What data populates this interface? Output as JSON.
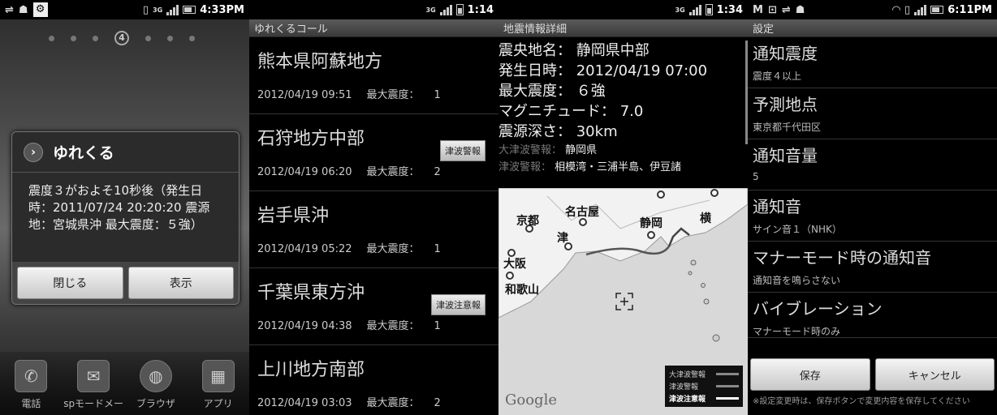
{
  "screen1": {
    "status_time": "4:33PM",
    "page_indicator": "4",
    "dialog": {
      "title": "ゆれくる",
      "body": "震度３がおよそ10秒後（発生日時：2011/07/24 20:20:20 震源地：宮城県沖 最大震度：５強）",
      "close_label": "閉じる",
      "show_label": "表示"
    },
    "dock": [
      {
        "label": "電話",
        "icon": "phone-icon"
      },
      {
        "label": "spモードメー",
        "icon": "mail-icon"
      },
      {
        "label": "ブラウザ",
        "icon": "globe-icon"
      },
      {
        "label": "アプリ",
        "icon": "grid-icon"
      }
    ]
  },
  "screen2": {
    "status_time": "1:14",
    "network": "3G",
    "title": "ゆれくるコール",
    "max_label": "最大震度：",
    "items": [
      {
        "place": "熊本県阿蘇地方",
        "datetime": "2012/04/19 09:51",
        "max": "1",
        "tag": ""
      },
      {
        "place": "石狩地方中部",
        "datetime": "2012/04/19 06:20",
        "max": "2",
        "tag": "津波警報"
      },
      {
        "place": "岩手県沖",
        "datetime": "2012/04/19 05:22",
        "max": "1",
        "tag": ""
      },
      {
        "place": "千葉県東方沖",
        "datetime": "2012/04/19 04:38",
        "max": "1",
        "tag": "津波注意報"
      },
      {
        "place": "上川地方南部",
        "datetime": "2012/04/19 03:03",
        "max": "2",
        "tag": ""
      }
    ]
  },
  "screen3": {
    "status_time": "1:34",
    "network": "3G",
    "title": "地震情報詳細",
    "rows": [
      {
        "label": "震央地名：",
        "value": "静岡県中部"
      },
      {
        "label": "発生日時：",
        "value": "2012/04/19 07:00"
      },
      {
        "label": "最大震度：",
        "value": "６強"
      },
      {
        "label": "マグニチュード：",
        "value": "7.0"
      },
      {
        "label": "震源深さ：",
        "value": "30km"
      }
    ],
    "small_rows": [
      {
        "label": "大津波警報：",
        "value": "静岡県"
      },
      {
        "label": "津波警報：",
        "value": "相模湾・三浦半島、伊豆諸"
      }
    ],
    "map": {
      "cities": [
        "京都",
        "名古屋",
        "静岡",
        "津",
        "大阪",
        "和歌山",
        "横"
      ],
      "legend": [
        "大津波警報",
        "津波警報",
        "津波注意報"
      ],
      "attribution": "Google"
    }
  },
  "screen4": {
    "status_time": "6:11PM",
    "title": "設定",
    "items": [
      {
        "title": "通知震度",
        "value": "震度４以上"
      },
      {
        "title": "予測地点",
        "value": "東京都千代田区"
      },
      {
        "title": "通知音量",
        "value": "5"
      },
      {
        "title": "通知音",
        "value": "サイン音１（NHK）"
      },
      {
        "title": "マナーモード時の通知音",
        "value": "通知音を鳴らさない"
      },
      {
        "title": "バイブレーション",
        "value": "マナーモード時のみ"
      }
    ],
    "save_label": "保存",
    "cancel_label": "キャンセル",
    "note": "※設定変更時は、保存ボタンで変更内容を保存してください"
  }
}
